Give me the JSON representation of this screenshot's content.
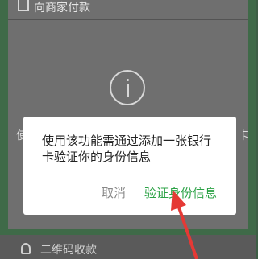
{
  "background": {
    "pay_header_label": "向商家付款",
    "left_clipped_char": "使",
    "right_clipped_char": "卡"
  },
  "modal": {
    "message": "使用该功能需通过添加一张银行卡验证你的身份信息",
    "cancel_label": "取消",
    "verify_label": "验证身份信息"
  },
  "bottom": {
    "qr_label": "二维码收款"
  },
  "colors": {
    "accent": "#2ba245",
    "annotation_arrow": "#e53935"
  },
  "icons": {
    "pay_header_icon": "box-icon",
    "info_icon": "info-circle-icon",
    "qr_icon": "person-icon"
  }
}
